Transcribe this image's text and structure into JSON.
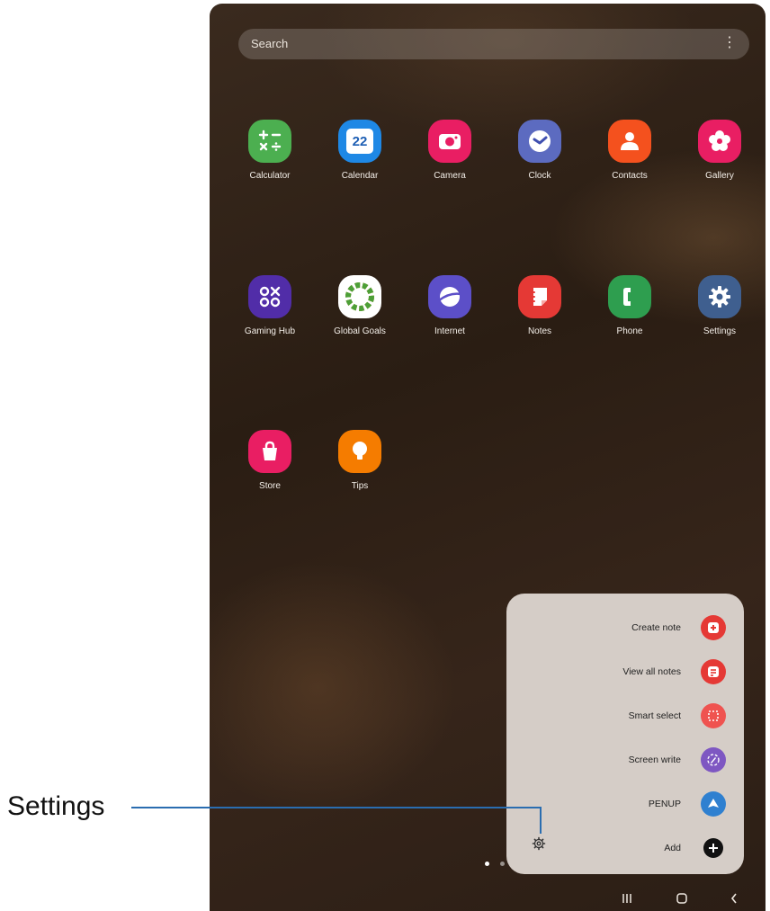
{
  "search": {
    "placeholder": "Search"
  },
  "apps": [
    {
      "label": "Calculator",
      "icon": "calculator-icon",
      "color": "#4caf50"
    },
    {
      "label": "Calendar",
      "icon": "calendar-icon",
      "color": "#1e88e5",
      "day": "22"
    },
    {
      "label": "Camera",
      "icon": "camera-icon",
      "color": "#e91e63"
    },
    {
      "label": "Clock",
      "icon": "clock-icon",
      "color": "#5c6bc0"
    },
    {
      "label": "Contacts",
      "icon": "contacts-icon",
      "color": "#f4511e"
    },
    {
      "label": "Gallery",
      "icon": "gallery-icon",
      "color": "#e91e63"
    },
    {
      "label": "Gaming Hub",
      "icon": "gaming-hub-icon",
      "color": "#512da8"
    },
    {
      "label": "Global Goals",
      "icon": "global-goals-icon",
      "color": "#ffffff"
    },
    {
      "label": "Internet",
      "icon": "internet-icon",
      "color": "#5c4fc8"
    },
    {
      "label": "Notes",
      "icon": "notes-icon",
      "color": "#e53935"
    },
    {
      "label": "Phone",
      "icon": "phone-icon",
      "color": "#2e9e4f"
    },
    {
      "label": "Settings",
      "icon": "settings-icon",
      "color": "#3f5f8f"
    },
    {
      "label": "Store",
      "icon": "store-icon",
      "color": "#e91e63"
    },
    {
      "label": "Tips",
      "icon": "tips-icon",
      "color": "#f57c00"
    }
  ],
  "air_command": {
    "items": [
      {
        "label": "Create note",
        "icon": "create-note-icon",
        "color": "#e53935"
      },
      {
        "label": "View all notes",
        "icon": "view-all-notes-icon",
        "color": "#e53935"
      },
      {
        "label": "Smart select",
        "icon": "smart-select-icon",
        "color": "#ef5350"
      },
      {
        "label": "Screen write",
        "icon": "screen-write-icon",
        "color": "#7e57c2"
      },
      {
        "label": "PENUP",
        "icon": "penup-icon",
        "color": "#2f80d0"
      },
      {
        "label": "Add",
        "icon": "add-icon",
        "color": "#111111"
      }
    ],
    "settings_icon": "gear-icon"
  },
  "callout": {
    "label": "Settings"
  },
  "nav": {
    "recents": "recents-icon",
    "home": "home-icon",
    "back": "back-icon"
  }
}
